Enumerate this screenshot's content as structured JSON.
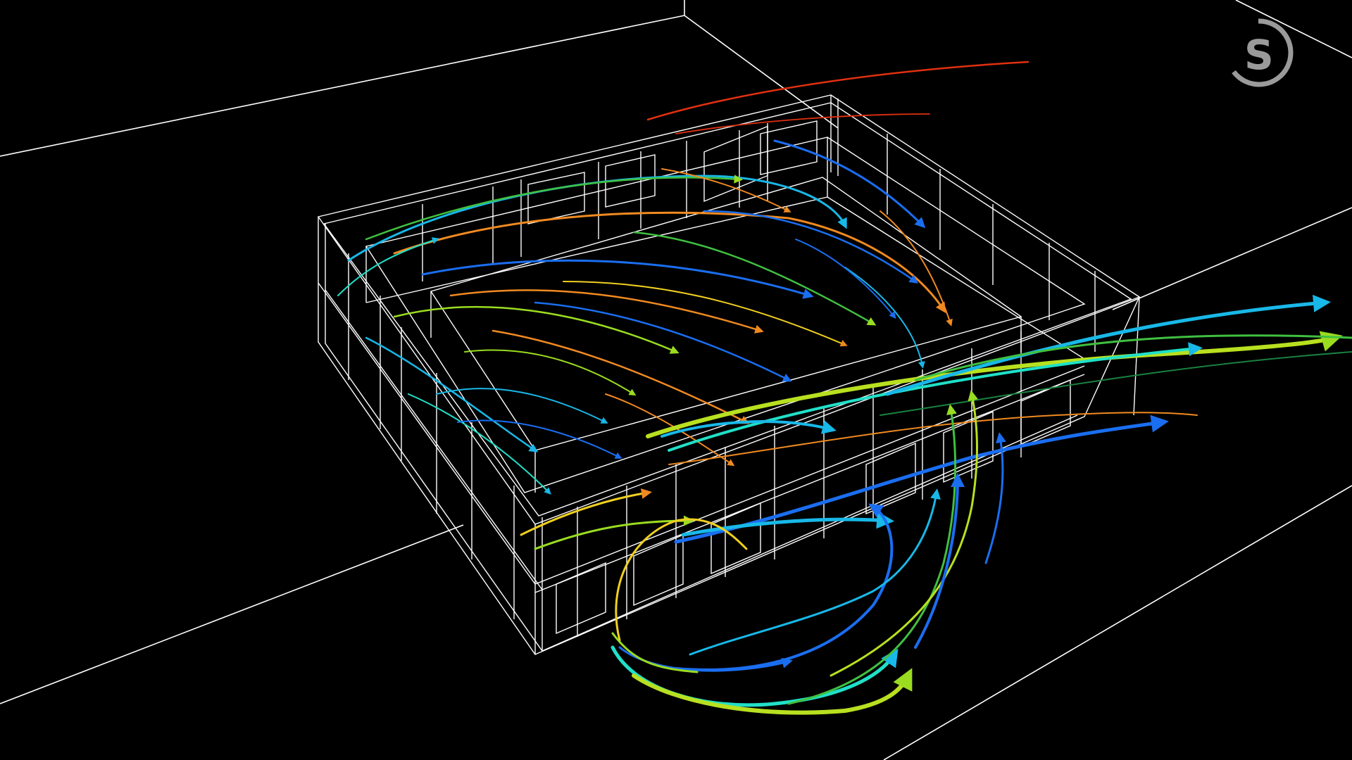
{
  "viewport": {
    "background": "#000000",
    "view": "3d-wireframe-perspective"
  },
  "model": {
    "wireframe_color": "#ffffff",
    "ground_color": "#ffffff"
  },
  "streamlines": {
    "color_scale": [
      "#1060e8",
      "#10b0e0",
      "#20e0c8",
      "#40c040",
      "#b8e020",
      "#f0d020",
      "#f08020",
      "#e03010"
    ]
  },
  "logo": {
    "icon": "brand-s-logo-icon",
    "color": "#9a9a9a"
  }
}
